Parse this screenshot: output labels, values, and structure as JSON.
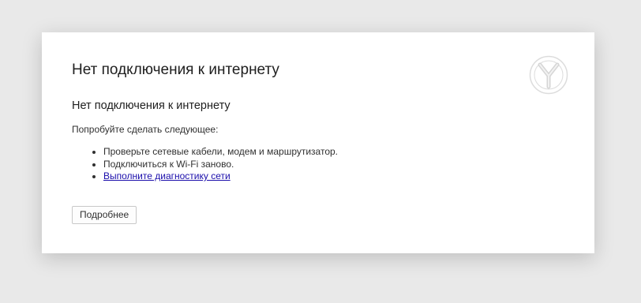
{
  "error_page": {
    "title": "Нет подключения к интернету",
    "subtitle": "Нет подключения к интернету",
    "hint": "Попробуйте сделать следующее:",
    "suggestions": [
      "Проверьте сетевые кабели, модем и маршрутизатор.",
      "Подключиться к Wi-Fi заново."
    ],
    "diagnostics_link": "Выполните диагностику сети",
    "more_button": "Подробнее",
    "logo_icon": "yandex-browser-logo-icon",
    "colors": {
      "background": "#e9e9e9",
      "card": "#ffffff",
      "link": "#1a0dab",
      "logo": "#dcdcdc"
    }
  }
}
